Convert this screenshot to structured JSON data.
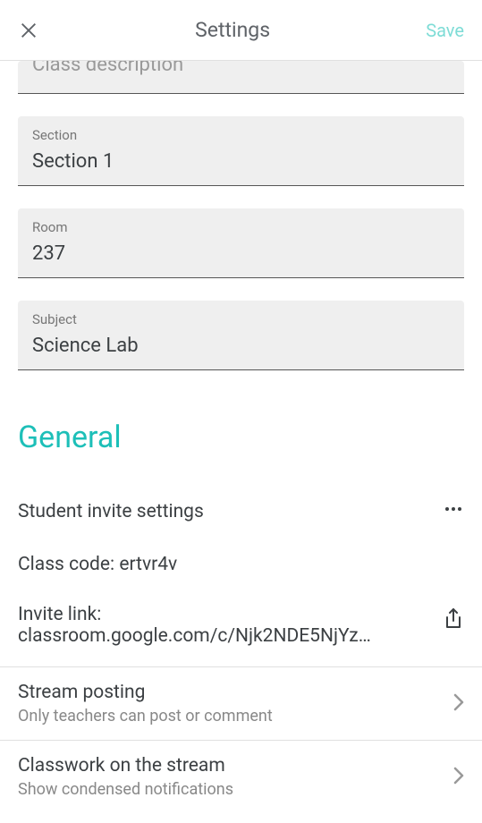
{
  "header": {
    "title": "Settings",
    "save_label": "Save"
  },
  "fields": {
    "truncated_label": "Class description",
    "section_label": "Section",
    "section_value": "Section 1",
    "room_label": "Room",
    "room_value": "237",
    "subject_label": "Subject",
    "subject_value": "Science Lab"
  },
  "general": {
    "heading": "General",
    "invite_settings_label": "Student invite settings",
    "class_code_label": "Class code: ",
    "class_code_value": "ertvr4v",
    "invite_link_label": "Invite link:",
    "invite_link_value": "classroom.google.com/c/Njk2NDE5NjYz…",
    "stream_posting_label": "Stream posting",
    "stream_posting_sub": "Only teachers can post or comment",
    "classwork_label": "Classwork on the stream",
    "classwork_sub": "Show condensed notifications"
  }
}
